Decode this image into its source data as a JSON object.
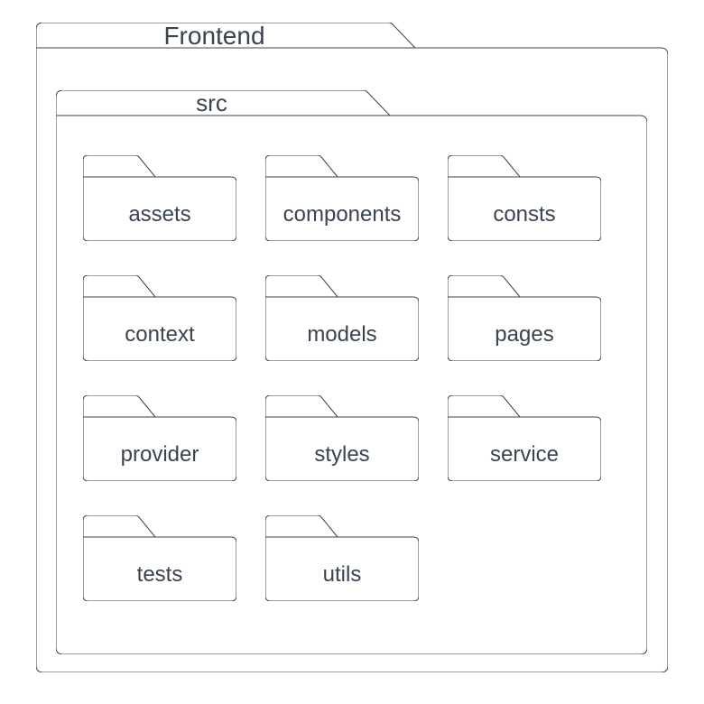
{
  "outer": {
    "label": "Frontend"
  },
  "inner": {
    "label": "src"
  },
  "folders": [
    {
      "label": "assets"
    },
    {
      "label": "components"
    },
    {
      "label": "consts"
    },
    {
      "label": "context"
    },
    {
      "label": "models"
    },
    {
      "label": "pages"
    },
    {
      "label": "provider"
    },
    {
      "label": "styles"
    },
    {
      "label": "service"
    },
    {
      "label": "tests"
    },
    {
      "label": "utils"
    }
  ],
  "colors": {
    "stroke": "#3a4351",
    "text": "#3a4351"
  }
}
